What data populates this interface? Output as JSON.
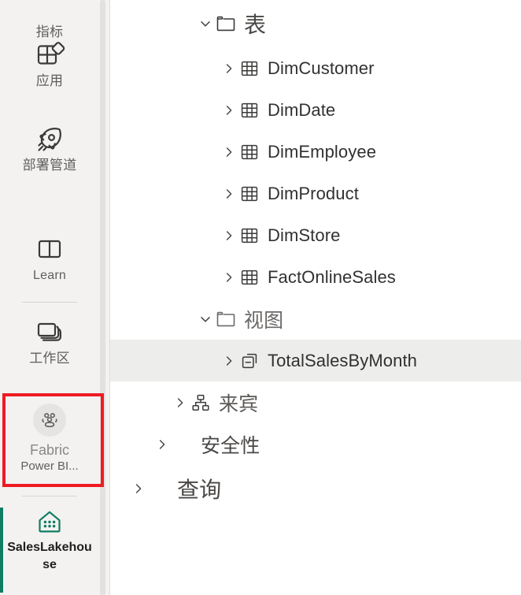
{
  "rail": {
    "items": [
      {
        "id": "metrics",
        "label": "指标",
        "icon": "metrics-icon"
      },
      {
        "id": "apps",
        "label": "应用",
        "icon": "apps-grid-icon"
      },
      {
        "id": "pipelines",
        "label": "部署管道",
        "icon": "rocket-icon"
      },
      {
        "id": "learn",
        "label": "Learn",
        "icon": "book-icon"
      },
      {
        "id": "workspaces",
        "label": "工作区",
        "icon": "layers-icon"
      }
    ],
    "fabric": {
      "title": "Fabric",
      "subtitle": "Power BI...",
      "icon": "people-group-icon"
    },
    "lakehouse": {
      "label": "SalesLakehouse",
      "icon": "lakehouse-icon"
    }
  },
  "highlight": {
    "color": "#ee1b24",
    "target": "fabric"
  },
  "tree": {
    "nodes": [
      {
        "id": "tables",
        "label": "表",
        "icon": "folder-icon",
        "expanded": true,
        "chevron": "down",
        "indent": 0,
        "selected": false
      },
      {
        "id": "dimcustomer",
        "label": "DimCustomer",
        "icon": "table-icon",
        "expanded": false,
        "chevron": "right",
        "indent": 1,
        "selected": false
      },
      {
        "id": "dimdate",
        "label": "DimDate",
        "icon": "table-icon",
        "expanded": false,
        "chevron": "right",
        "indent": 1,
        "selected": false
      },
      {
        "id": "dimemployee",
        "label": "DimEmployee",
        "icon": "table-icon",
        "expanded": false,
        "chevron": "right",
        "indent": 1,
        "selected": false
      },
      {
        "id": "dimproduct",
        "label": "DimProduct",
        "icon": "table-icon",
        "expanded": false,
        "chevron": "right",
        "indent": 1,
        "selected": false
      },
      {
        "id": "dimstore",
        "label": "DimStore",
        "icon": "table-icon",
        "expanded": false,
        "chevron": "right",
        "indent": 1,
        "selected": false
      },
      {
        "id": "factonlinesales",
        "label": "FactOnlineSales",
        "icon": "table-icon",
        "expanded": false,
        "chevron": "right",
        "indent": 1,
        "selected": false
      },
      {
        "id": "views",
        "label": "视图",
        "icon": "folder-icon",
        "expanded": true,
        "chevron": "down",
        "indent": 0,
        "selected": false
      },
      {
        "id": "totalsalesbymonth",
        "label": "TotalSalesByMonth",
        "icon": "view-icon",
        "expanded": false,
        "chevron": "right",
        "indent": 1,
        "selected": true
      },
      {
        "id": "guest",
        "label": "来宾",
        "icon": "hierarchy-icon",
        "expanded": false,
        "chevron": "right",
        "indent": 0,
        "selected": false
      },
      {
        "id": "security",
        "label": "安全性",
        "icon": "none",
        "expanded": false,
        "chevron": "right",
        "indent": 0,
        "selected": false
      },
      {
        "id": "queries",
        "label": "查询",
        "icon": "none",
        "expanded": false,
        "chevron": "right",
        "indent": 0,
        "selected": false
      }
    ]
  }
}
